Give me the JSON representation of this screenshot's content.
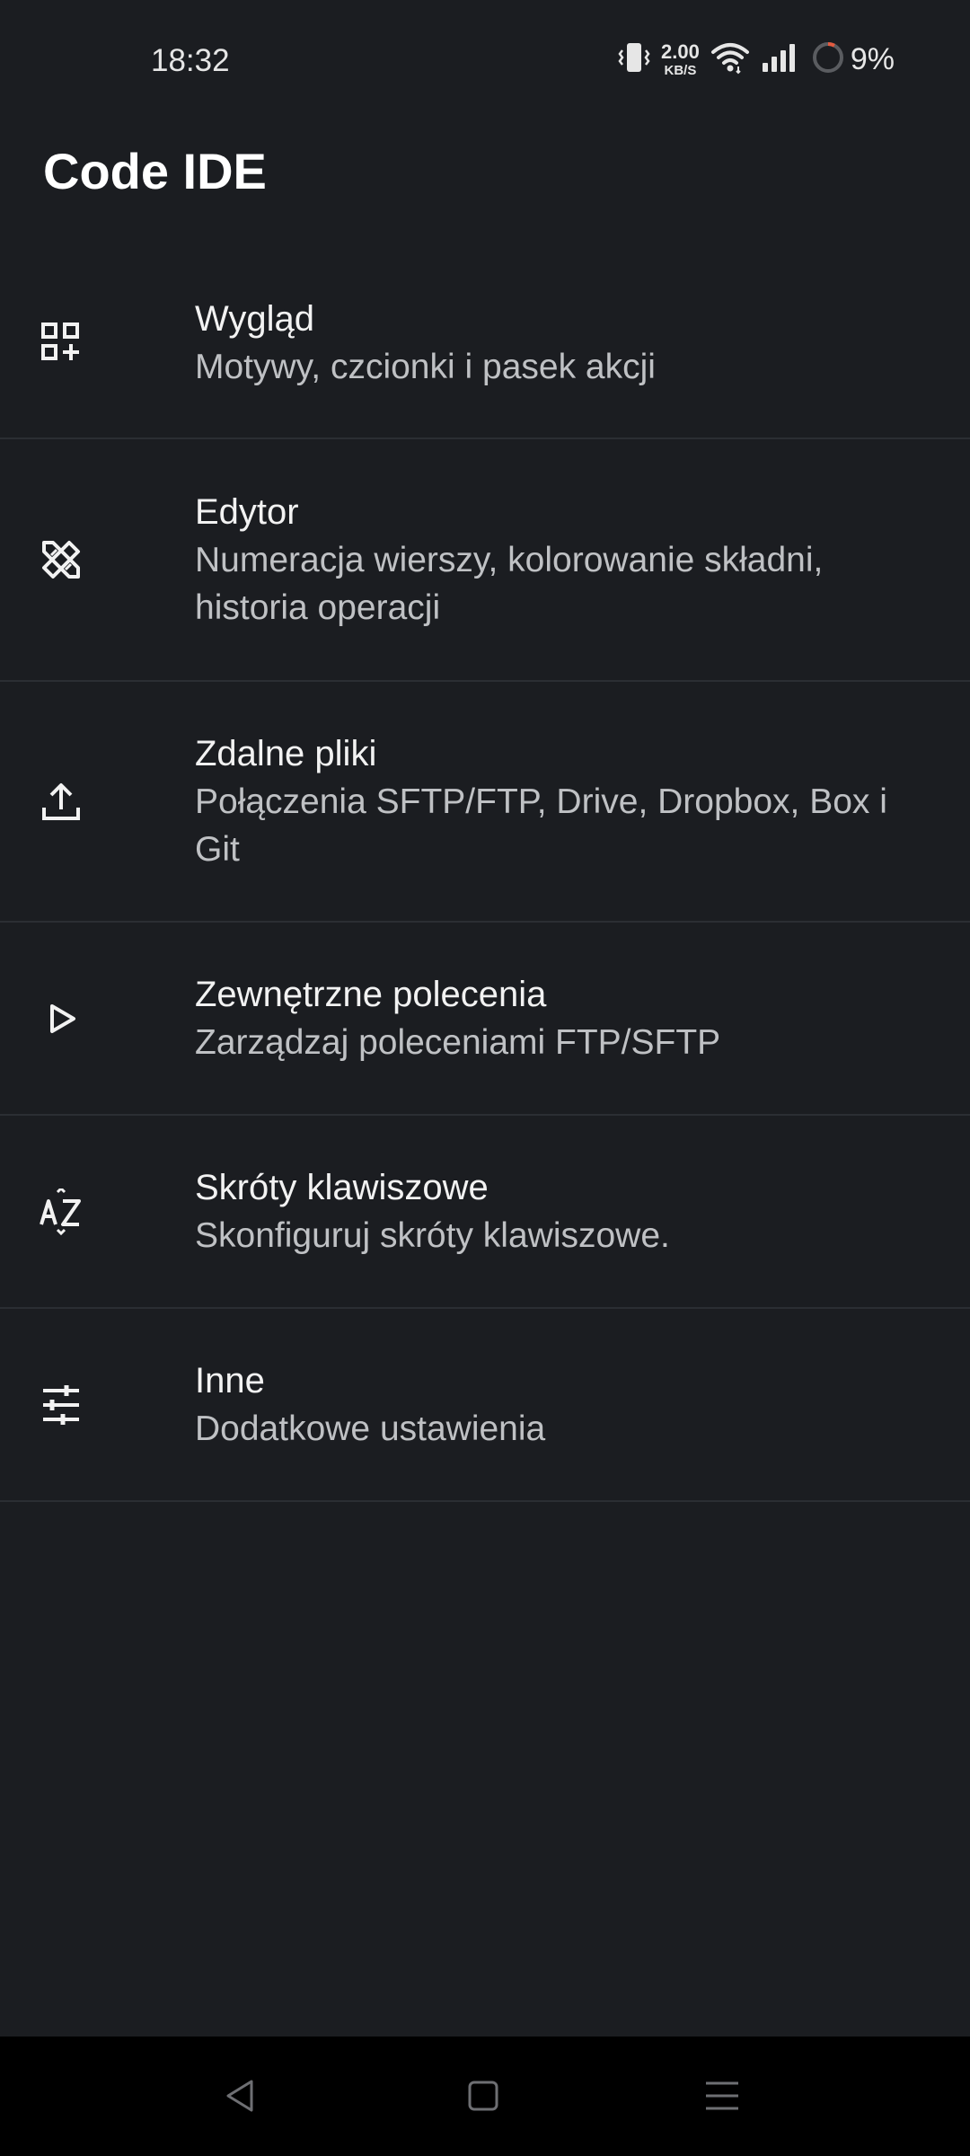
{
  "status_bar": {
    "time": "18:32",
    "net_speed_value": "2.00",
    "net_speed_unit": "KB/S",
    "battery_percent": "9%",
    "icons": [
      "vibrate-icon",
      "wifi-icon",
      "signal-icon",
      "battery-icon"
    ]
  },
  "app": {
    "title": "Code IDE"
  },
  "settings": {
    "items": [
      {
        "icon": "widgets-icon",
        "title": "Wygląd",
        "subtitle": "Motywy, czcionki i pasek akcji"
      },
      {
        "icon": "tools-icon",
        "title": "Edytor",
        "subtitle": "Numeracja wierszy, kolorowanie składni, historia operacji"
      },
      {
        "icon": "upload-icon",
        "title": "Zdalne pliki",
        "subtitle": "Połączenia SFTP/FTP, Drive, Dropbox, Box i Git"
      },
      {
        "icon": "play-icon",
        "title": "Zewnętrzne polecenia",
        "subtitle": "Zarządzaj poleceniami FTP/SFTP"
      },
      {
        "icon": "sort-az-icon",
        "title": "Skróty klawiszowe",
        "subtitle": "Skonfiguruj skróty klawiszowe."
      },
      {
        "icon": "tune-icon",
        "title": "Inne",
        "subtitle": "Dodatkowe ustawienia"
      }
    ]
  },
  "nav_bar": {
    "buttons": [
      "back-icon",
      "home-icon",
      "recents-icon"
    ]
  },
  "colors": {
    "background": "#1b1d21",
    "divider": "#2b2e33",
    "title_text": "#f2f2f2",
    "subtitle_text": "#bfc1c4",
    "nav_background": "#000000"
  }
}
